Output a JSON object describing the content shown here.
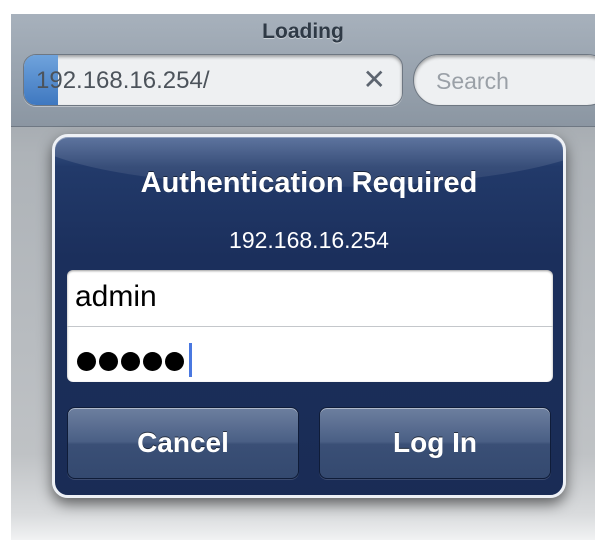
{
  "browser": {
    "title": "Loading",
    "url": "192.168.16.254/",
    "load_progress": 0.09,
    "clear_glyph": "✕",
    "search_placeholder": "Search"
  },
  "dialog": {
    "title": "Authentication Required",
    "host": "192.168.16.254",
    "username": "admin",
    "password_length": 5,
    "cancel_label": "Cancel",
    "login_label": "Log In"
  },
  "colors": {
    "dialog_bg": "#1b2f5c",
    "progress": "#4a82c8",
    "caret": "#4a78e0"
  }
}
